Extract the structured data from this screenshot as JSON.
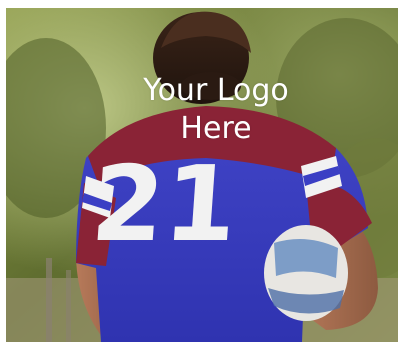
{
  "overlay": {
    "line1": "Your Logo",
    "line2": "Here"
  },
  "photo": {
    "jersey_number": "21",
    "subject": "rugby-player-back-view",
    "colors": {
      "jersey_blue": "#3b3fc4",
      "jersey_maroon": "#8a2336",
      "stripe_white": "#f2f2f2",
      "foliage": "#6b7a3a",
      "sky_light": "#b9c58a"
    }
  }
}
